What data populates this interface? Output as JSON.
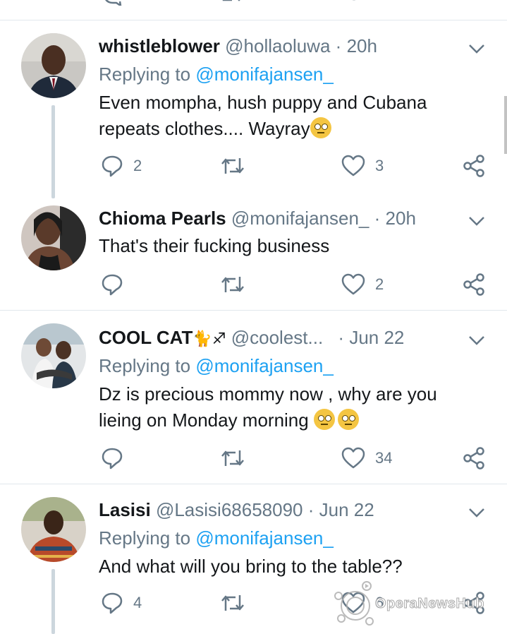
{
  "tweets": [
    {
      "name": "whistleblower",
      "handle": "@hollaoluwa",
      "time": "20h",
      "replying_label": "Replying to",
      "replying_handle": "@monifajansen_",
      "text_line1": "Even mompha, hush puppy and Cubana",
      "text_line2": "repeats clothes.... Wayray",
      "reply_count": "2",
      "retweet_count": "",
      "like_count": "3"
    },
    {
      "name": "Chioma Pearls",
      "handle": "@monifajansen_",
      "time": "20h",
      "text_line1": "That's their fucking business",
      "reply_count": "",
      "retweet_count": "",
      "like_count": "2"
    },
    {
      "name": "COOL CAT",
      "name_emoji": "🐈♐",
      "handle": "@coolest...",
      "time": "Jun 22",
      "replying_label": "Replying to",
      "replying_handle": "@monifajansen_",
      "text_line1": "Dz is precious mommy now , why are you",
      "text_line2": "lieing on Monday morning",
      "reply_count": "",
      "retweet_count": "",
      "like_count": "34"
    },
    {
      "name": "Lasisi",
      "handle": "@Lasisi68658090",
      "time": "Jun 22",
      "replying_label": "Replying to",
      "replying_handle": "@monifajansen_",
      "text_line1": "And what will you bring to the table??",
      "reply_count": "4",
      "retweet_count": "",
      "like_count": "6"
    }
  ],
  "separator": "·",
  "watermark": "OperaNewsHub",
  "colors": {
    "link": "#1da1f2",
    "secondary": "#657786",
    "divider": "#e1e8ed"
  }
}
